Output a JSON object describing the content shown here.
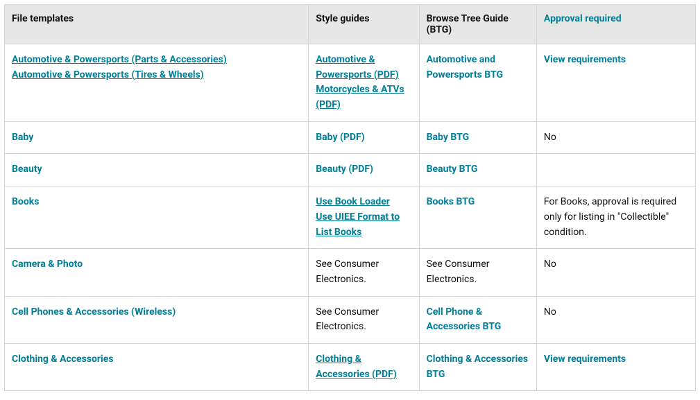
{
  "headers": {
    "file_templates": "File templates",
    "style_guides": "Style guides",
    "btg": "Browse Tree Guide (BTG)",
    "approval": "Approval required"
  },
  "rows": [
    {
      "file_templates": [
        {
          "text": "Automotive & Powersports (Parts & Accessories)",
          "link": true,
          "underline": true
        },
        {
          "text": "Automotive & Powersports (Tires & Wheels)",
          "link": true,
          "underline": true
        }
      ],
      "style_guides": [
        {
          "text": "Automotive & Powersports (PDF)",
          "link": true,
          "underline": true
        },
        {
          "text": "Motorcycles & ATVs (PDF)",
          "link": true,
          "underline": true
        }
      ],
      "btg": [
        {
          "text": "Automotive and Powersports BTG",
          "link": true,
          "underline": false
        }
      ],
      "approval": [
        {
          "text": "View requirements",
          "link": true,
          "underline": false
        }
      ]
    },
    {
      "file_templates": [
        {
          "text": "Baby",
          "link": true,
          "underline": false
        }
      ],
      "style_guides": [
        {
          "text": "Baby (PDF)",
          "link": true,
          "underline": false
        }
      ],
      "btg": [
        {
          "text": "Baby BTG",
          "link": true,
          "underline": false
        }
      ],
      "approval": [
        {
          "text": "No",
          "link": false,
          "underline": false
        }
      ]
    },
    {
      "file_templates": [
        {
          "text": "Beauty",
          "link": true,
          "underline": false
        }
      ],
      "style_guides": [
        {
          "text": "Beauty (PDF)",
          "link": true,
          "underline": false
        }
      ],
      "btg": [
        {
          "text": "Beauty BTG",
          "link": true,
          "underline": false
        }
      ],
      "approval": []
    },
    {
      "file_templates": [
        {
          "text": "Books",
          "link": true,
          "underline": false
        }
      ],
      "style_guides": [
        {
          "text": "Use Book Loader",
          "link": true,
          "underline": true
        },
        {
          "text": "Use UIEE Format to List Books",
          "link": true,
          "underline": true
        }
      ],
      "btg": [
        {
          "text": "Books BTG",
          "link": true,
          "underline": false
        }
      ],
      "approval": [
        {
          "text": "For Books, approval is required only for listing in \"Collectible\" condition.",
          "link": false,
          "underline": false
        }
      ]
    },
    {
      "file_templates": [
        {
          "text": "Camera & Photo",
          "link": true,
          "underline": false
        }
      ],
      "style_guides": [
        {
          "text": "See Consumer Electronics.",
          "link": false,
          "underline": false
        }
      ],
      "btg": [
        {
          "text": "See Consumer Electronics.",
          "link": false,
          "underline": false
        }
      ],
      "approval": [
        {
          "text": "No",
          "link": false,
          "underline": false
        }
      ]
    },
    {
      "file_templates": [
        {
          "text": "Cell Phones & Accessories (Wireless)",
          "link": true,
          "underline": false
        }
      ],
      "style_guides": [
        {
          "text": "See Consumer Electronics.",
          "link": false,
          "underline": false
        }
      ],
      "btg": [
        {
          "text": "Cell Phone & Accessories BTG",
          "link": true,
          "underline": false
        }
      ],
      "approval": [
        {
          "text": "No",
          "link": false,
          "underline": false
        }
      ]
    },
    {
      "file_templates": [
        {
          "text": "Clothing & Accessories",
          "link": true,
          "underline": false
        }
      ],
      "style_guides": [
        {
          "text": "Clothing & Accessories (PDF)",
          "link": true,
          "underline": true
        }
      ],
      "btg": [
        {
          "text": "Clothing & Accessories BTG",
          "link": true,
          "underline": false
        }
      ],
      "approval": [
        {
          "text": "View requirements",
          "link": true,
          "underline": false
        }
      ]
    }
  ]
}
